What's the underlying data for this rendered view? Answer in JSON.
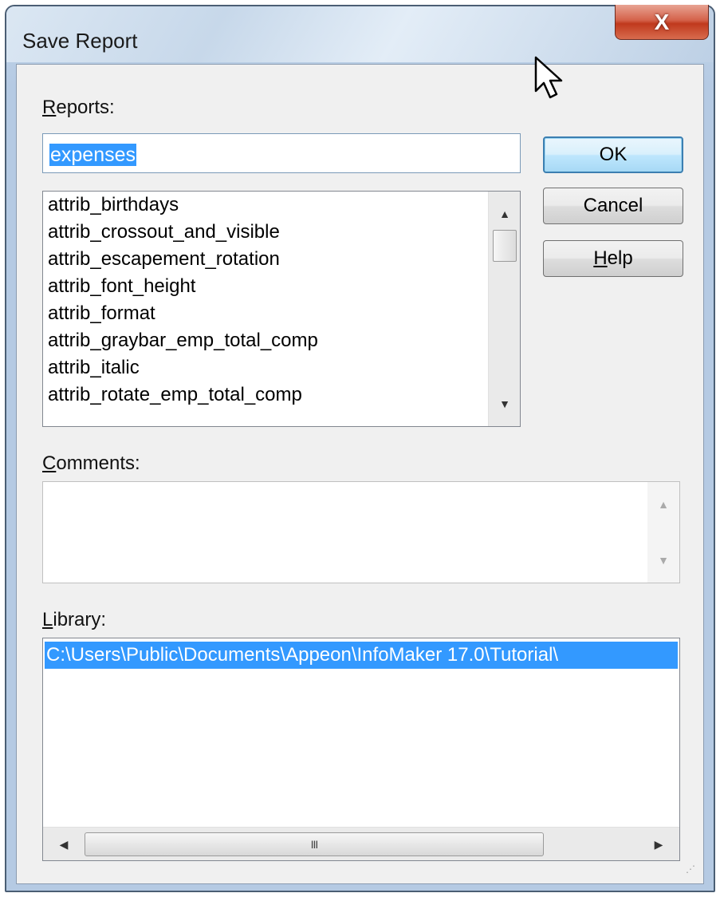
{
  "window": {
    "title": "Save Report",
    "close_glyph": "X"
  },
  "reports": {
    "label_prefix": "",
    "label_accel": "R",
    "label_rest": "eports:",
    "input_value": "expenses",
    "items": [
      "attrib_birthdays",
      "attrib_crossout_and_visible",
      "attrib_escapement_rotation",
      "attrib_font_height",
      "attrib_format",
      "attrib_graybar_emp_total_comp",
      "attrib_italic",
      "attrib_rotate_emp_total_comp"
    ]
  },
  "buttons": {
    "ok": "OK",
    "cancel": "Cancel",
    "help_accel": "H",
    "help_rest": "elp"
  },
  "comments": {
    "label_accel": "C",
    "label_rest": "omments:",
    "value": ""
  },
  "library": {
    "label_accel": "L",
    "label_rest": "ibrary:",
    "selected_path": "C:\\Users\\Public\\Documents\\Appeon\\InfoMaker 17.0\\Tutorial\\"
  },
  "icons": {
    "scroll_up": "▲",
    "scroll_down": "▼",
    "scroll_left": "◀",
    "scroll_right": "▶",
    "thumb_grip": "III",
    "size_grip": "⋰"
  }
}
